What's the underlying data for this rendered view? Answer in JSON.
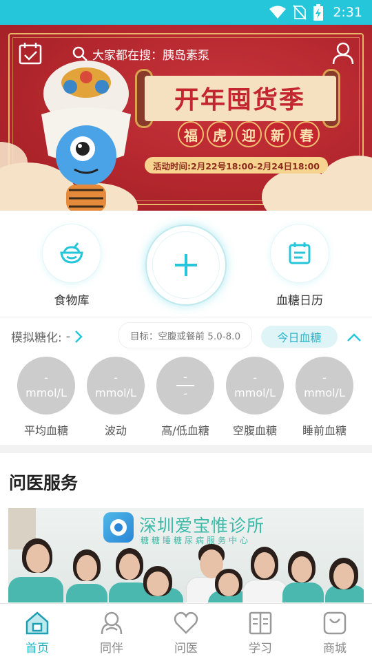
{
  "status_bar": {
    "time": "2:31"
  },
  "banner": {
    "search_prefix": "大家都在搜：",
    "search_keyword": "胰岛素泵",
    "title": "开年囤货季",
    "seals": [
      "福",
      "虎",
      "迎",
      "新",
      "春"
    ],
    "activity_time": "活动时间:2月22号18:00-2月24日18:00"
  },
  "quick_actions": {
    "food_library": "食物库",
    "glucose_calendar": "血糖日历"
  },
  "summary": {
    "hba1c_label": "模拟糖化:",
    "hba1c_value": "-",
    "target_text": "目标：空腹或餐前 5.0-8.0",
    "today_button": "今日血糖"
  },
  "stats": [
    {
      "value": "-",
      "unit": "mmol/L",
      "label": "平均血糖"
    },
    {
      "value": "-",
      "unit": "mmol/L",
      "label": "波动"
    },
    {
      "high": "-",
      "low": "-",
      "label": "高/低血糖"
    },
    {
      "value": "-",
      "unit": "mmol/L",
      "label": "空腹血糖"
    },
    {
      "value": "-",
      "unit": "mmol/L",
      "label": "睡前血糖"
    }
  ],
  "section": {
    "title": "问医服务"
  },
  "clinic": {
    "name": "深圳爱宝惟诊所",
    "subtitle": "糖糖睡糖尿病服务中心"
  },
  "bottom_nav": [
    {
      "label": "首页",
      "icon": "home-icon",
      "active": true
    },
    {
      "label": "同伴",
      "icon": "peer-icon",
      "active": false
    },
    {
      "label": "问医",
      "icon": "heart-icon",
      "active": false
    },
    {
      "label": "学习",
      "icon": "book-icon",
      "active": false
    },
    {
      "label": "商城",
      "icon": "shop-bag-icon",
      "active": false
    }
  ],
  "colors": {
    "accent": "#26c6da",
    "banner_red": "#b3262d",
    "stat_gray": "#cccccc"
  }
}
